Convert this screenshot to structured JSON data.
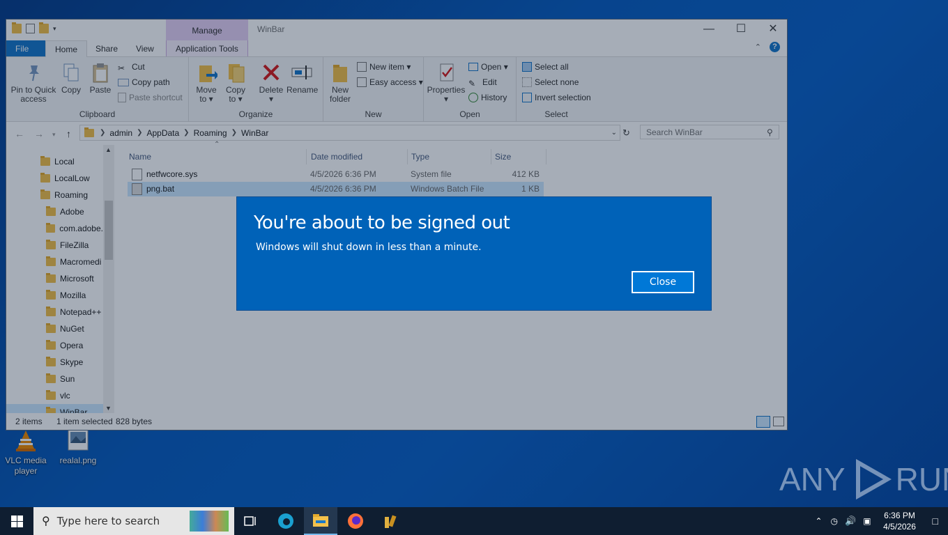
{
  "desktop": {
    "icons": [
      {
        "label": "VLC media player",
        "line1": "VLC media",
        "line2": "player"
      },
      {
        "label": "realal.png"
      }
    ]
  },
  "explorer": {
    "title": "WinBar",
    "manage_label": "Manage",
    "tabs": {
      "file": "File",
      "home": "Home",
      "share": "Share",
      "view": "View",
      "app_tools": "Application Tools"
    },
    "ribbon": {
      "clipboard": {
        "pin_line1": "Pin to Quick",
        "pin_line2": "access",
        "copy": "Copy",
        "paste": "Paste",
        "cut": "Cut",
        "copy_path": "Copy path",
        "paste_shortcut": "Paste shortcut",
        "label": "Clipboard"
      },
      "organize": {
        "move_line1": "Move",
        "move_line2": "to ▾",
        "copy_line1": "Copy",
        "copy_line2": "to ▾",
        "delete_line1": "Delete",
        "delete_line2": "▾",
        "rename": "Rename",
        "label": "Organize"
      },
      "new": {
        "new_folder_line1": "New",
        "new_folder_line2": "folder",
        "new_item": "New item ▾",
        "easy_access": "Easy access ▾",
        "label": "New"
      },
      "open": {
        "properties_line1": "Properties",
        "properties_line2": "▾",
        "open": "Open ▾",
        "edit": "Edit",
        "history": "History",
        "label": "Open"
      },
      "select": {
        "select_all": "Select all",
        "select_none": "Select none",
        "invert": "Invert selection",
        "label": "Select"
      }
    },
    "address": {
      "segments": [
        "admin",
        "AppData",
        "Roaming",
        "WinBar"
      ],
      "search_placeholder": "Search WinBar"
    },
    "nav": [
      {
        "label": "Local",
        "indent": 0
      },
      {
        "label": "LocalLow",
        "indent": 0
      },
      {
        "label": "Roaming",
        "indent": 0
      },
      {
        "label": "Adobe",
        "indent": 1
      },
      {
        "label": "com.adobe.",
        "indent": 1
      },
      {
        "label": "FileZilla",
        "indent": 1
      },
      {
        "label": "Macromedi",
        "indent": 1
      },
      {
        "label": "Microsoft",
        "indent": 1
      },
      {
        "label": "Mozilla",
        "indent": 1
      },
      {
        "label": "Notepad++",
        "indent": 1
      },
      {
        "label": "NuGet",
        "indent": 1
      },
      {
        "label": "Opera",
        "indent": 1
      },
      {
        "label": "Skype",
        "indent": 1
      },
      {
        "label": "Sun",
        "indent": 1
      },
      {
        "label": "vlc",
        "indent": 1
      },
      {
        "label": "WinBar",
        "indent": 1,
        "selected": true
      }
    ],
    "columns": {
      "name": "Name",
      "date": "Date modified",
      "type": "Type",
      "size": "Size"
    },
    "files": [
      {
        "name": "netfwcore.sys",
        "date": "4/5/2026 6:36 PM",
        "type": "System file",
        "size": "412 KB"
      },
      {
        "name": "png.bat",
        "date": "4/5/2026 6:36 PM",
        "type": "Windows Batch File",
        "size": "1 KB",
        "selected": true
      }
    ],
    "status": {
      "items": "2 items",
      "selected": "1 item selected",
      "bytes": "828 bytes"
    }
  },
  "dialog": {
    "title": "You're about to be signed out",
    "message": "Windows will shut down in less than a minute.",
    "close_label": "Close"
  },
  "watermark": {
    "text_left": "ANY",
    "text_right": "RUN"
  },
  "taskbar": {
    "search_placeholder": "Type here to search",
    "time": "6:36 PM",
    "date": "4/5/2026"
  }
}
